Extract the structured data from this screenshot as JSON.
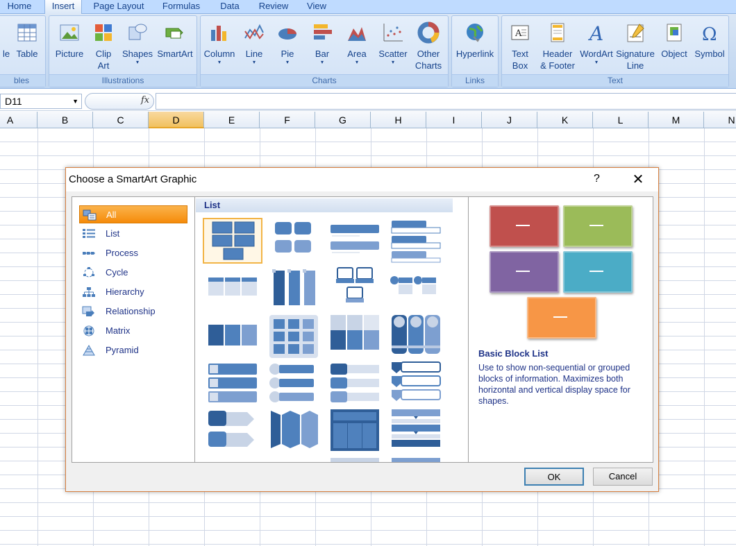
{
  "tabs": [
    "Home",
    "Insert",
    "Page Layout",
    "Formulas",
    "Data",
    "Review",
    "View"
  ],
  "ribbon": {
    "groups": {
      "tables": "bles",
      "illustrations": "Illustrations",
      "charts": "Charts",
      "links": "Links",
      "text": "Text"
    },
    "buttons": {
      "pivot": "le",
      "table": "Table",
      "picture": "Picture",
      "clipart": "Clip Art",
      "shapes": "Shapes",
      "smartart": "SmartArt",
      "column": "Column",
      "line": "Line",
      "pie": "Pie",
      "bar": "Bar",
      "area": "Area",
      "scatter": "Scatter",
      "other_charts": "Other Charts",
      "hyperlink": "Hyperlink",
      "textbox": "Text Box",
      "header_footer": "Header & Footer",
      "wordart": "WordArt",
      "signature": "Signature Line",
      "object": "Object",
      "symbol": "Symbol"
    }
  },
  "formula_bar": {
    "name_box": "D11",
    "fx": "fx",
    "value": ""
  },
  "columns": [
    "A",
    "B",
    "C",
    "D",
    "E",
    "F",
    "G",
    "H",
    "I",
    "J",
    "K",
    "L",
    "M",
    "N"
  ],
  "selected_column": "D",
  "dialog": {
    "title": "Choose a SmartArt Graphic",
    "help": "?",
    "close": "✕",
    "categories": [
      "All",
      "List",
      "Process",
      "Cycle",
      "Hierarchy",
      "Relationship",
      "Matrix",
      "Pyramid"
    ],
    "selected_category": "All",
    "gallery_header": "List",
    "selected_layout": "Basic Block List",
    "preview_title": "Basic Block List",
    "preview_description": "Use to show non-sequential or grouped blocks of information. Maximizes both horizontal and vertical display space for shapes.",
    "preview_colors": [
      "#c0504d",
      "#9bbb59",
      "#8064a2",
      "#4bacc6",
      "#f79646"
    ],
    "ok": "OK",
    "cancel": "Cancel"
  }
}
